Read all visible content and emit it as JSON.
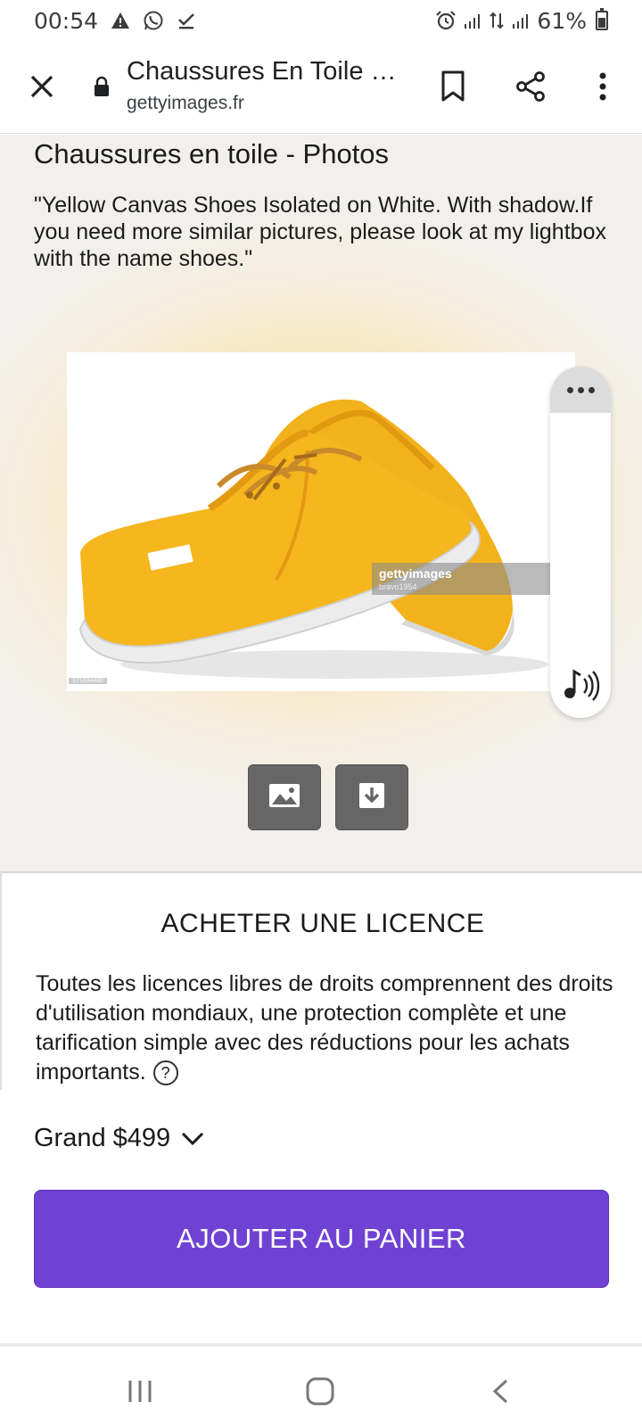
{
  "status_bar": {
    "time": "00:54",
    "battery": "61%",
    "icons": [
      "alert-icon",
      "whatsapp-icon",
      "download-done-icon",
      "alarm-icon",
      "signal-icon",
      "data-icon",
      "signal-icon",
      "battery-icon"
    ]
  },
  "toolbar": {
    "title": "Chaussures En Toile …",
    "url": "gettyimages.fr",
    "icons": [
      "close-icon",
      "lock-icon",
      "bookmark-icon",
      "share-icon",
      "more-vert-icon"
    ]
  },
  "page": {
    "heading": "Chaussures en toile - Photos",
    "caption": "\"Yellow Canvas Shoes Isolated on White. With shadow.If you need more similar pictures, please look at my lightbox with the name shoes.\""
  },
  "photo": {
    "watermark_logo": "gettyimages",
    "watermark_credit": "bravo1954",
    "photo_id": "171004480",
    "subject": "yellow canvas shoes"
  },
  "side_panel": {
    "icons": [
      "more-horiz-icon",
      "audio-icon"
    ]
  },
  "actions": {
    "icons": [
      "image-icon",
      "download-icon"
    ]
  },
  "license": {
    "title": "ACHETER UNE LICENCE",
    "text": "Toutes les licences libres de droits comprennent des droits d'utilisation mondiaux, une protection complète et une tarification simple avec des réductions pour les achats importants.",
    "help": "?"
  },
  "purchase": {
    "size_price": "Grand $499",
    "add_to_cart": "AJOUTER AU PANIER"
  },
  "navbar": {
    "icons": [
      "recent-apps-icon",
      "home-icon",
      "back-icon"
    ]
  },
  "colors": {
    "accent": "#6f42d4",
    "action_button": "#666666",
    "shoe": "#f2b21c"
  }
}
